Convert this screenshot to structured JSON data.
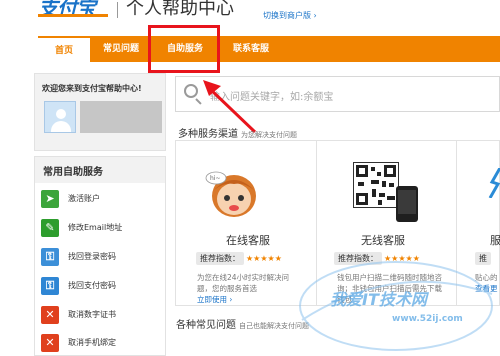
{
  "header": {
    "logo_text": "支付宝",
    "title": "个人帮助中心",
    "switch_link": "切换到商户版 ›"
  },
  "nav": {
    "items": [
      "首页",
      "常见问题",
      "自助服务",
      "联系客服"
    ]
  },
  "welcome": "欢迎您来到支付宝帮助中心!",
  "sidebar": {
    "title": "常用自助服务",
    "items": [
      {
        "label": "激活账户",
        "icon": "activate-icon",
        "color": "#3ba53a"
      },
      {
        "label": "修改Email地址",
        "icon": "email-icon",
        "color": "#2d9d2d"
      },
      {
        "label": "找回登录密码",
        "icon": "key-icon",
        "color": "#3c8fd8"
      },
      {
        "label": "找回支付密码",
        "icon": "pay-key-icon",
        "color": "#2f86d4"
      },
      {
        "label": "取消数字证书",
        "icon": "cancel-cert-icon",
        "color": "#e0401d"
      },
      {
        "label": "取消手机绑定",
        "icon": "cancel-phone-icon",
        "color": "#e0401d"
      }
    ]
  },
  "search": {
    "placeholder": "输入问题关键字，如:余额宝"
  },
  "services": {
    "title": "多种服务渠道",
    "subtitle": "为您解决支付问题",
    "channels": [
      {
        "name": "在线客服",
        "rec_label": "推荐指数：",
        "stars": "★★★★★",
        "desc": "为您在线24小时实时解决问题，您的服务首选",
        "link": "立即使用 ›"
      },
      {
        "name": "无线客服",
        "rec_label": "推荐指数：",
        "stars": "★★★★★",
        "desc": "钱包用户扫描二维码随时随地咨询；非钱包用户扫描后需先下载钱包"
      },
      {
        "name": "服",
        "rec_label": "推",
        "desc": "贴心的",
        "link": "查看更"
      }
    ]
  },
  "faq": {
    "title": "各种常见问题",
    "subtitle": "自己也能解决支付问题"
  },
  "watermark": {
    "text": "我爱IT技术网",
    "url": "www.52ij.com"
  },
  "colors": {
    "accent": "#f08300",
    "link": "#1a73c8",
    "highlight": "#e8141c"
  }
}
